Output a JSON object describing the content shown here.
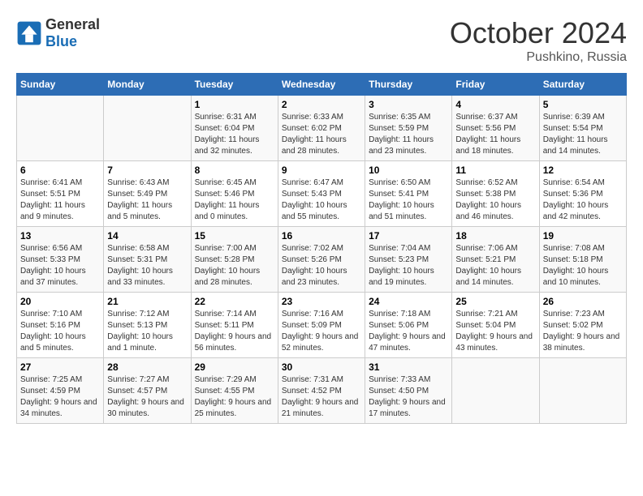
{
  "header": {
    "logo_general": "General",
    "logo_blue": "Blue",
    "month": "October 2024",
    "location": "Pushkino, Russia"
  },
  "weekdays": [
    "Sunday",
    "Monday",
    "Tuesday",
    "Wednesday",
    "Thursday",
    "Friday",
    "Saturday"
  ],
  "weeks": [
    [
      {
        "day": "",
        "info": ""
      },
      {
        "day": "",
        "info": ""
      },
      {
        "day": "1",
        "info": "Sunrise: 6:31 AM\nSunset: 6:04 PM\nDaylight: 11 hours and 32 minutes."
      },
      {
        "day": "2",
        "info": "Sunrise: 6:33 AM\nSunset: 6:02 PM\nDaylight: 11 hours and 28 minutes."
      },
      {
        "day": "3",
        "info": "Sunrise: 6:35 AM\nSunset: 5:59 PM\nDaylight: 11 hours and 23 minutes."
      },
      {
        "day": "4",
        "info": "Sunrise: 6:37 AM\nSunset: 5:56 PM\nDaylight: 11 hours and 18 minutes."
      },
      {
        "day": "5",
        "info": "Sunrise: 6:39 AM\nSunset: 5:54 PM\nDaylight: 11 hours and 14 minutes."
      }
    ],
    [
      {
        "day": "6",
        "info": "Sunrise: 6:41 AM\nSunset: 5:51 PM\nDaylight: 11 hours and 9 minutes."
      },
      {
        "day": "7",
        "info": "Sunrise: 6:43 AM\nSunset: 5:49 PM\nDaylight: 11 hours and 5 minutes."
      },
      {
        "day": "8",
        "info": "Sunrise: 6:45 AM\nSunset: 5:46 PM\nDaylight: 11 hours and 0 minutes."
      },
      {
        "day": "9",
        "info": "Sunrise: 6:47 AM\nSunset: 5:43 PM\nDaylight: 10 hours and 55 minutes."
      },
      {
        "day": "10",
        "info": "Sunrise: 6:50 AM\nSunset: 5:41 PM\nDaylight: 10 hours and 51 minutes."
      },
      {
        "day": "11",
        "info": "Sunrise: 6:52 AM\nSunset: 5:38 PM\nDaylight: 10 hours and 46 minutes."
      },
      {
        "day": "12",
        "info": "Sunrise: 6:54 AM\nSunset: 5:36 PM\nDaylight: 10 hours and 42 minutes."
      }
    ],
    [
      {
        "day": "13",
        "info": "Sunrise: 6:56 AM\nSunset: 5:33 PM\nDaylight: 10 hours and 37 minutes."
      },
      {
        "day": "14",
        "info": "Sunrise: 6:58 AM\nSunset: 5:31 PM\nDaylight: 10 hours and 33 minutes."
      },
      {
        "day": "15",
        "info": "Sunrise: 7:00 AM\nSunset: 5:28 PM\nDaylight: 10 hours and 28 minutes."
      },
      {
        "day": "16",
        "info": "Sunrise: 7:02 AM\nSunset: 5:26 PM\nDaylight: 10 hours and 23 minutes."
      },
      {
        "day": "17",
        "info": "Sunrise: 7:04 AM\nSunset: 5:23 PM\nDaylight: 10 hours and 19 minutes."
      },
      {
        "day": "18",
        "info": "Sunrise: 7:06 AM\nSunset: 5:21 PM\nDaylight: 10 hours and 14 minutes."
      },
      {
        "day": "19",
        "info": "Sunrise: 7:08 AM\nSunset: 5:18 PM\nDaylight: 10 hours and 10 minutes."
      }
    ],
    [
      {
        "day": "20",
        "info": "Sunrise: 7:10 AM\nSunset: 5:16 PM\nDaylight: 10 hours and 5 minutes."
      },
      {
        "day": "21",
        "info": "Sunrise: 7:12 AM\nSunset: 5:13 PM\nDaylight: 10 hours and 1 minute."
      },
      {
        "day": "22",
        "info": "Sunrise: 7:14 AM\nSunset: 5:11 PM\nDaylight: 9 hours and 56 minutes."
      },
      {
        "day": "23",
        "info": "Sunrise: 7:16 AM\nSunset: 5:09 PM\nDaylight: 9 hours and 52 minutes."
      },
      {
        "day": "24",
        "info": "Sunrise: 7:18 AM\nSunset: 5:06 PM\nDaylight: 9 hours and 47 minutes."
      },
      {
        "day": "25",
        "info": "Sunrise: 7:21 AM\nSunset: 5:04 PM\nDaylight: 9 hours and 43 minutes."
      },
      {
        "day": "26",
        "info": "Sunrise: 7:23 AM\nSunset: 5:02 PM\nDaylight: 9 hours and 38 minutes."
      }
    ],
    [
      {
        "day": "27",
        "info": "Sunrise: 7:25 AM\nSunset: 4:59 PM\nDaylight: 9 hours and 34 minutes."
      },
      {
        "day": "28",
        "info": "Sunrise: 7:27 AM\nSunset: 4:57 PM\nDaylight: 9 hours and 30 minutes."
      },
      {
        "day": "29",
        "info": "Sunrise: 7:29 AM\nSunset: 4:55 PM\nDaylight: 9 hours and 25 minutes."
      },
      {
        "day": "30",
        "info": "Sunrise: 7:31 AM\nSunset: 4:52 PM\nDaylight: 9 hours and 21 minutes."
      },
      {
        "day": "31",
        "info": "Sunrise: 7:33 AM\nSunset: 4:50 PM\nDaylight: 9 hours and 17 minutes."
      },
      {
        "day": "",
        "info": ""
      },
      {
        "day": "",
        "info": ""
      }
    ]
  ]
}
